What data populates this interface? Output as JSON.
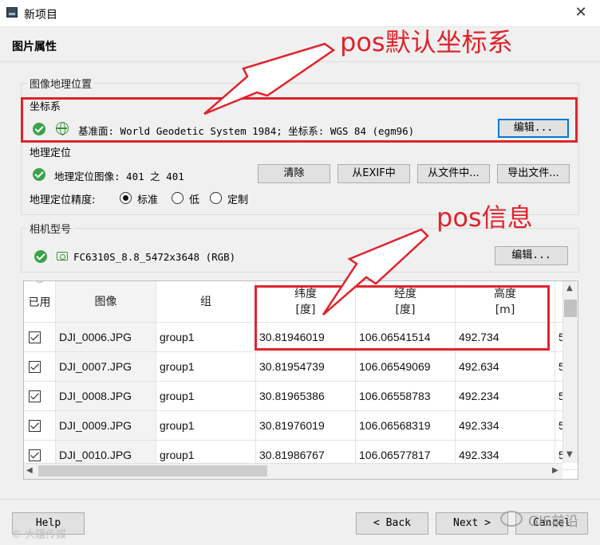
{
  "window": {
    "title": "新项目",
    "close_glyph": "✕"
  },
  "page": {
    "heading": "图片属性"
  },
  "geo_location": {
    "group_title": "图像地理位置",
    "crs": {
      "title": "坐标系",
      "icon": "globe-icon",
      "text": "基准面: World Geodetic System 1984; 坐标系: WGS 84 (egm96)",
      "edit_label": "编辑..."
    },
    "georef": {
      "title": "地理定位",
      "text": "地理定位图像: 401 之 401",
      "buttons": {
        "clear": "清除",
        "from_exif": "从EXIF中",
        "from_file": "从文件中...",
        "export_file": "导出文件..."
      },
      "accuracy_label": "地理定位精度:",
      "options": [
        "标准",
        "低",
        "定制"
      ],
      "selected": "标准"
    }
  },
  "camera": {
    "group_title": "相机型号",
    "icon": "camera-icon",
    "model": "FC6310S_8.8_5472x3648 (RGB)",
    "edit_label": "编辑..."
  },
  "table": {
    "headers": {
      "enabled": "已用",
      "image": "图像",
      "group": "组",
      "lat": "纬度",
      "lat_unit": "[度]",
      "lon": "经度",
      "lon_unit": "[度]",
      "alt": "高度",
      "alt_unit": "[m]"
    },
    "rows": [
      {
        "image": "DJI_0006.JPG",
        "group": "group1",
        "lat": "30.81946019",
        "lon": "106.06541514",
        "alt": "492.734",
        "extra": "5"
      },
      {
        "image": "DJI_0007.JPG",
        "group": "group1",
        "lat": "30.81954739",
        "lon": "106.06549069",
        "alt": "492.634",
        "extra": "5"
      },
      {
        "image": "DJI_0008.JPG",
        "group": "group1",
        "lat": "30.81965386",
        "lon": "106.06558783",
        "alt": "492.234",
        "extra": "5"
      },
      {
        "image": "DJI_0009.JPG",
        "group": "group1",
        "lat": "30.81976019",
        "lon": "106.06568319",
        "alt": "492.334",
        "extra": "5"
      },
      {
        "image": "DJI_0010.JPG",
        "group": "group1",
        "lat": "30.81986767",
        "lon": "106.06577817",
        "alt": "492.334",
        "extra": "5"
      }
    ]
  },
  "annotations": {
    "crs": "pos默认坐标系",
    "info": "pos信息",
    "color": "#e0232b"
  },
  "footer": {
    "help": "Help",
    "back": "< Back",
    "next": "Next >",
    "cancel": "Cancel"
  },
  "watermark": {
    "right": "GIS前沿",
    "left": "© 大疆传媒"
  }
}
